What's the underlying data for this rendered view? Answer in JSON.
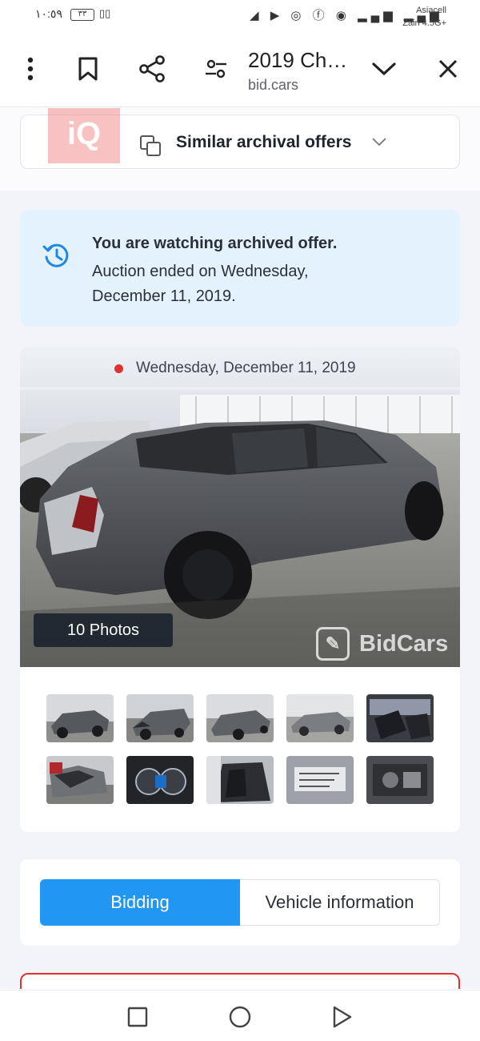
{
  "status_bar": {
    "time": "١٠:٥٩",
    "battery": "٣٣",
    "carrier_1": "Asiacell",
    "carrier_2": "Zain 4.5G+"
  },
  "toolbar": {
    "title": "2019 Ch…",
    "url": "bid.cars"
  },
  "similar_offers": {
    "label": "Similar archival offers"
  },
  "watermark": {
    "logo_text": "iQ"
  },
  "archived_notice": {
    "title": "You are watching archived offer.",
    "text": "Auction ended on Wednesday, December 11, 2019."
  },
  "gallery": {
    "date": "Wednesday, December 11, 2019",
    "photos_count": "10 Photos",
    "watermark": "BidCars"
  },
  "tabs": {
    "bidding": "Bidding",
    "vehicle_information": "Vehicle information"
  },
  "colors": {
    "accent": "#2196f3",
    "notice_bg": "#e3f2fd",
    "alert_red": "#e03131"
  }
}
